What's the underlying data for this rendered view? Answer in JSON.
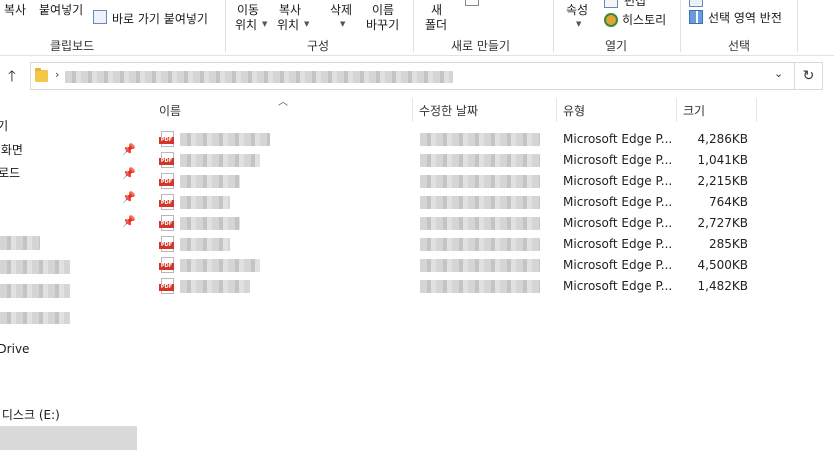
{
  "ribbon": {
    "clipboard": {
      "copy_label": "복사",
      "paste_label": "붙여넣기",
      "paste_shortcut_label": "바로 가기 붙여넣기",
      "group_label": "클립보드"
    },
    "organize": {
      "move_label_1": "이동",
      "move_label_2": "위치",
      "copy_label_1": "복사",
      "copy_label_2": "위치",
      "delete_label": "삭제",
      "rename_label_1": "이름",
      "rename_label_2": "바꾸기",
      "group_label": "구성"
    },
    "new": {
      "new_folder_label_1": "새",
      "new_folder_label_2": "폴더",
      "group_label": "새로 만들기"
    },
    "open": {
      "properties_label": "속성",
      "edit_label": "편집",
      "history_label": "히스토리",
      "group_label": "열기"
    },
    "select": {
      "invert_label": "선택 영역 반전",
      "group_label": "선택"
    }
  },
  "nav": {
    "items": [
      {
        "label": "즐겨찾기"
      },
      {
        "label": "바탕 화면"
      },
      {
        "label": "다운로드"
      },
      {
        "label": "OneDrive"
      },
      {
        "label": "로컬 디스크 (E:)"
      }
    ]
  },
  "list": {
    "columns": {
      "name": "이름",
      "date": "수정한 날짜",
      "type": "유형",
      "size": "크기"
    },
    "icon_tag": "PDF",
    "rows": [
      {
        "type": "Microsoft Edge P...",
        "size": "4,286KB"
      },
      {
        "type": "Microsoft Edge P...",
        "size": "1,041KB"
      },
      {
        "type": "Microsoft Edge P...",
        "size": "2,215KB"
      },
      {
        "type": "Microsoft Edge P...",
        "size": "764KB"
      },
      {
        "type": "Microsoft Edge P...",
        "size": "2,727KB"
      },
      {
        "type": "Microsoft Edge P...",
        "size": "285KB"
      },
      {
        "type": "Microsoft Edge P...",
        "size": "4,500KB"
      },
      {
        "type": "Microsoft Edge P...",
        "size": "1,482KB"
      }
    ]
  },
  "colors": {
    "pdf_red": "#d4352b",
    "folder_yellow": "#f3c74a",
    "selection_gray": "#d9d9d9"
  }
}
